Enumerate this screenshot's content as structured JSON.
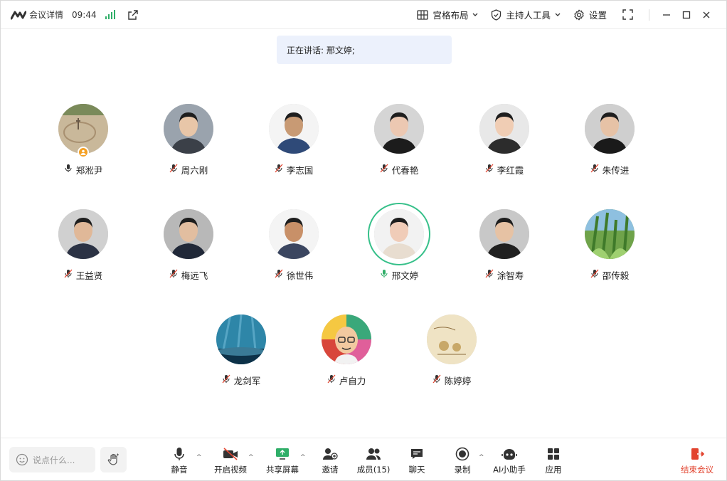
{
  "window": {
    "title": "会议详情",
    "time": "09:44",
    "layout_label": "宫格布局",
    "host_tools_label": "主持人工具",
    "settings_label": "设置"
  },
  "speaking_banner": "正在讲话: 邢文婷;",
  "participants": [
    {
      "name": "郑淞尹",
      "mic": "on",
      "host": true
    },
    {
      "name": "周六刚",
      "mic": "muted"
    },
    {
      "name": "李志国",
      "mic": "muted"
    },
    {
      "name": "代春艳",
      "mic": "muted"
    },
    {
      "name": "李红霞",
      "mic": "muted"
    },
    {
      "name": "朱传进",
      "mic": "muted"
    },
    {
      "name": "王益贤",
      "mic": "muted"
    },
    {
      "name": "梅远飞",
      "mic": "muted"
    },
    {
      "name": "徐世伟",
      "mic": "muted"
    },
    {
      "name": "邢文婷",
      "mic": "speaking"
    },
    {
      "name": "涂智寿",
      "mic": "muted"
    },
    {
      "name": "邵传毅",
      "mic": "muted"
    },
    {
      "name": "龙剑军",
      "mic": "muted"
    },
    {
      "name": "卢自力",
      "mic": "muted"
    },
    {
      "name": "陈婷婷",
      "mic": "muted"
    }
  ],
  "toolbar": {
    "chat_placeholder": "说点什么...",
    "mute": "静音",
    "video": "开启视频",
    "share": "共享屏幕",
    "invite": "邀请",
    "members": "成员(15)",
    "chat": "聊天",
    "record": "录制",
    "ai": "AI小助手",
    "apps": "应用",
    "end": "结束会议"
  },
  "colors": {
    "accent_green": "#2fae68",
    "speaking_ring": "#37c08a",
    "end_red": "#e2442f",
    "banner_bg": "#ecf1fc"
  }
}
